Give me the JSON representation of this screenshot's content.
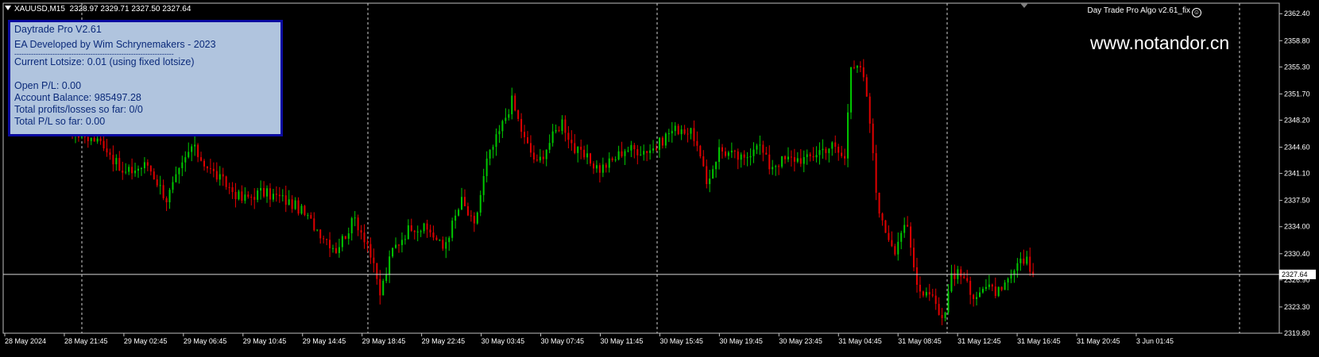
{
  "chart_header": {
    "symbol_timeframe": "XAUUSD,M15",
    "ohlc": "2328.97 2329.71 2327.50 2327.64"
  },
  "ea_label": "Day Trade Pro Algo v2.61_fix",
  "ea_icon": "smiley-icon",
  "watermark": "www.notandor.cn",
  "info_panel": {
    "title": "Daytrade Pro V2.61",
    "developer": "EA Developed by Wim Schrynemakers - 2023",
    "separator": "-------------------------------------------------------------------",
    "lotsize": "Current Lotsize: 0.01 (using fixed lotsize)",
    "open_pl": "Open P/L: 0.00",
    "balance": "Account Balance: 985497.28",
    "total_profits": "Total profits/losses so far: 0/0",
    "total_pl": "Total P/L so far: 0.00"
  },
  "colors": {
    "background": "#000000",
    "bull": "#00c800",
    "bear": "#e00000",
    "grid": "#ffffff",
    "panel_bg": "#b0c4de",
    "panel_border": "#0a0aa0",
    "panel_text": "#0b2a7a"
  },
  "chart_data": {
    "type": "candlestick",
    "symbol": "XAUUSD",
    "timeframe": "M15",
    "last_price": 2327.64,
    "current_price_label": "2327.64",
    "ylim": [
      2319.8,
      2363.8
    ],
    "y_ticks": [
      "2362.40",
      "2358.80",
      "2355.30",
      "2351.70",
      "2348.20",
      "2344.60",
      "2341.10",
      "2337.50",
      "2334.00",
      "2330.40",
      "2326.90",
      "2323.30",
      "2319.80"
    ],
    "x_ticks": [
      "28 May 2024",
      "28 May 21:45",
      "29 May 02:45",
      "29 May 06:45",
      "29 May 10:45",
      "29 May 14:45",
      "29 May 18:45",
      "29 May 22:45",
      "30 May 03:45",
      "30 May 07:45",
      "30 May 11:45",
      "30 May 15:45",
      "30 May 19:45",
      "30 May 23:45",
      "31 May 04:45",
      "31 May 08:45",
      "31 May 12:45",
      "31 May 16:45",
      "31 May 20:45",
      "3 Jun 01:45"
    ],
    "day_separators": [
      "29 May",
      "30 May",
      "31 May",
      "3 Jun"
    ],
    "close_path": [
      {
        "bar": 0,
        "price": 2355.5
      },
      {
        "bar": 6,
        "price": 2352.0
      },
      {
        "bar": 14,
        "price": 2348.6
      },
      {
        "bar": 22,
        "price": 2346.4
      },
      {
        "bar": 30,
        "price": 2345.1
      },
      {
        "bar": 36,
        "price": 2341.0
      },
      {
        "bar": 44,
        "price": 2342.3
      },
      {
        "bar": 50,
        "price": 2337.7
      },
      {
        "bar": 58,
        "price": 2344.7
      },
      {
        "bar": 64,
        "price": 2341.5
      },
      {
        "bar": 70,
        "price": 2339.2
      },
      {
        "bar": 74,
        "price": 2337.6
      },
      {
        "bar": 80,
        "price": 2338.6
      },
      {
        "bar": 86,
        "price": 2337.9
      },
      {
        "bar": 92,
        "price": 2336.5
      },
      {
        "bar": 98,
        "price": 2333.7
      },
      {
        "bar": 104,
        "price": 2331.0
      },
      {
        "bar": 110,
        "price": 2335.1
      },
      {
        "bar": 114,
        "price": 2331.8
      },
      {
        "bar": 118,
        "price": 2325.0
      },
      {
        "bar": 122,
        "price": 2330.9
      },
      {
        "bar": 128,
        "price": 2334.2
      },
      {
        "bar": 134,
        "price": 2333.4
      },
      {
        "bar": 138,
        "price": 2331.1
      },
      {
        "bar": 144,
        "price": 2337.4
      },
      {
        "bar": 148,
        "price": 2333.9
      },
      {
        "bar": 152,
        "price": 2342.7
      },
      {
        "bar": 156,
        "price": 2346.6
      },
      {
        "bar": 160,
        "price": 2350.8
      },
      {
        "bar": 164,
        "price": 2345.6
      },
      {
        "bar": 168,
        "price": 2342.3
      },
      {
        "bar": 172,
        "price": 2345.3
      },
      {
        "bar": 176,
        "price": 2348.1
      },
      {
        "bar": 180,
        "price": 2344.2
      },
      {
        "bar": 184,
        "price": 2343.0
      },
      {
        "bar": 188,
        "price": 2341.7
      },
      {
        "bar": 192,
        "price": 2342.8
      },
      {
        "bar": 196,
        "price": 2344.4
      },
      {
        "bar": 202,
        "price": 2344.2
      },
      {
        "bar": 206,
        "price": 2344.6
      },
      {
        "bar": 210,
        "price": 2346.6
      },
      {
        "bar": 214,
        "price": 2347.2
      },
      {
        "bar": 218,
        "price": 2346.1
      },
      {
        "bar": 222,
        "price": 2339.7
      },
      {
        "bar": 226,
        "price": 2344.3
      },
      {
        "bar": 230,
        "price": 2343.6
      },
      {
        "bar": 234,
        "price": 2342.8
      },
      {
        "bar": 238,
        "price": 2345.5
      },
      {
        "bar": 242,
        "price": 2342.1
      },
      {
        "bar": 246,
        "price": 2342.8
      },
      {
        "bar": 250,
        "price": 2343.1
      },
      {
        "bar": 254,
        "price": 2343.0
      },
      {
        "bar": 258,
        "price": 2344.2
      },
      {
        "bar": 262,
        "price": 2344.8
      },
      {
        "bar": 266,
        "price": 2343.0
      },
      {
        "bar": 268,
        "price": 2356.0
      },
      {
        "bar": 270,
        "price": 2355.7
      },
      {
        "bar": 272,
        "price": 2353.6
      },
      {
        "bar": 274,
        "price": 2347.9
      },
      {
        "bar": 276,
        "price": 2338.7
      },
      {
        "bar": 278,
        "price": 2334.3
      },
      {
        "bar": 282,
        "price": 2331.1
      },
      {
        "bar": 284,
        "price": 2333.5
      },
      {
        "bar": 286,
        "price": 2333.6
      },
      {
        "bar": 288,
        "price": 2328.6
      },
      {
        "bar": 290,
        "price": 2325.5
      },
      {
        "bar": 294,
        "price": 2325.3
      },
      {
        "bar": 296,
        "price": 2322.2
      },
      {
        "bar": 298,
        "price": 2322.5
      },
      {
        "bar": 300,
        "price": 2327.9
      },
      {
        "bar": 304,
        "price": 2327.3
      },
      {
        "bar": 306,
        "price": 2324.8
      },
      {
        "bar": 310,
        "price": 2325.9
      },
      {
        "bar": 316,
        "price": 2325.1
      },
      {
        "bar": 320,
        "price": 2328.1
      },
      {
        "bar": 324,
        "price": 2329.9
      },
      {
        "bar": 326,
        "price": 2327.64
      }
    ]
  }
}
